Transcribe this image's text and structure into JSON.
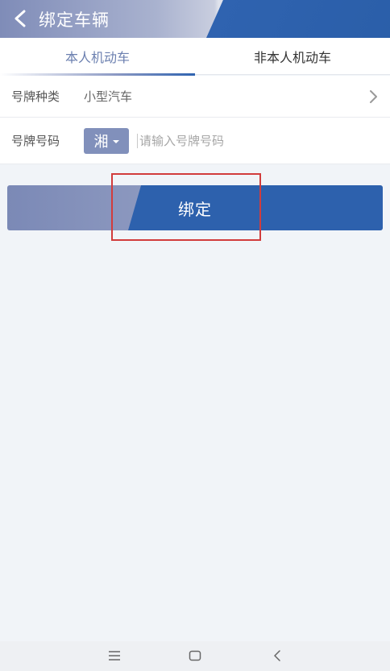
{
  "header": {
    "title": "绑定车辆",
    "back_icon": "chevron-left-icon"
  },
  "tabs": [
    {
      "label": "本人机动车",
      "active": true
    },
    {
      "label": "非本人机动车",
      "active": false
    }
  ],
  "form": {
    "plate_type": {
      "label": "号牌种类",
      "value": "小型汽车"
    },
    "plate_number": {
      "label": "号牌号码",
      "province": "湘",
      "placeholder": "请输入号牌号码",
      "value": ""
    }
  },
  "bind_button": {
    "label": "绑定"
  },
  "colors": {
    "accent": "#2d61ad",
    "accent_light": "#8190bb",
    "highlight": "#d23c3c"
  },
  "system_nav": [
    "menu-icon",
    "home-icon",
    "back-icon"
  ]
}
